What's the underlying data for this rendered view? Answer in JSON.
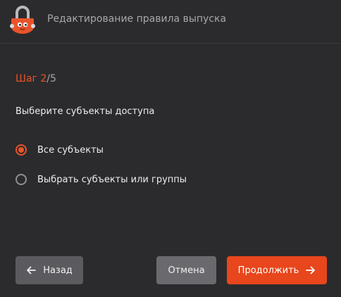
{
  "header": {
    "title": "Редактирование правила выпуска",
    "logo_icon": "lock-mascot-logo"
  },
  "step": {
    "label": "Шаг 2",
    "separator": "/",
    "total": "5"
  },
  "question": "Выберите субъекты доступа",
  "options": [
    {
      "label": "Все субъекты",
      "selected": true
    },
    {
      "label": "Выбрать субъекты или группы",
      "selected": false
    }
  ],
  "buttons": {
    "back": "Назад",
    "cancel": "Отмена",
    "next": "Продолжить"
  },
  "colors": {
    "accent": "#e8461c",
    "background": "#2b2b2d",
    "secondary_button": "#5b5b5f"
  }
}
